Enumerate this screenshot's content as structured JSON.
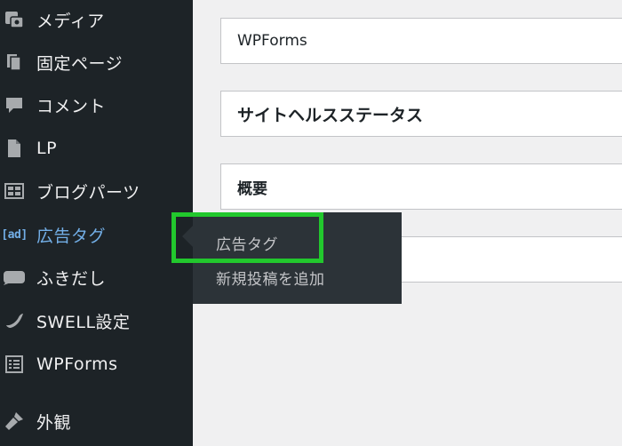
{
  "sidebar": {
    "items": [
      {
        "label": "メディア",
        "icon": "media-icon"
      },
      {
        "label": "固定ページ",
        "icon": "pages-icon"
      },
      {
        "label": "コメント",
        "icon": "comment-icon"
      },
      {
        "label": "LP",
        "icon": "document-icon"
      },
      {
        "label": "ブログパーツ",
        "icon": "blog-parts-icon"
      },
      {
        "label": "広告タグ",
        "icon": "ad-icon",
        "icon_text": "[ad]",
        "active": true
      },
      {
        "label": "ふきだし",
        "icon": "speech-bubble-icon"
      },
      {
        "label": "SWELL設定",
        "icon": "swell-icon"
      },
      {
        "label": "WPForms",
        "icon": "forms-icon"
      },
      {
        "label": "外観",
        "icon": "appearance-icon"
      }
    ]
  },
  "flyout": {
    "items": [
      {
        "label": "広告タグ"
      },
      {
        "label": "新規投稿を追加"
      }
    ]
  },
  "content": {
    "cards": [
      {
        "title": "WPForms"
      },
      {
        "title": "サイトヘルスステータス"
      },
      {
        "title": "概要"
      }
    ]
  },
  "colors": {
    "sidebar_bg": "#1d2327",
    "flyout_bg": "#2c3338",
    "active_text": "#72aee6",
    "highlight": "#22c82d",
    "page_bg": "#f0f0f1"
  }
}
